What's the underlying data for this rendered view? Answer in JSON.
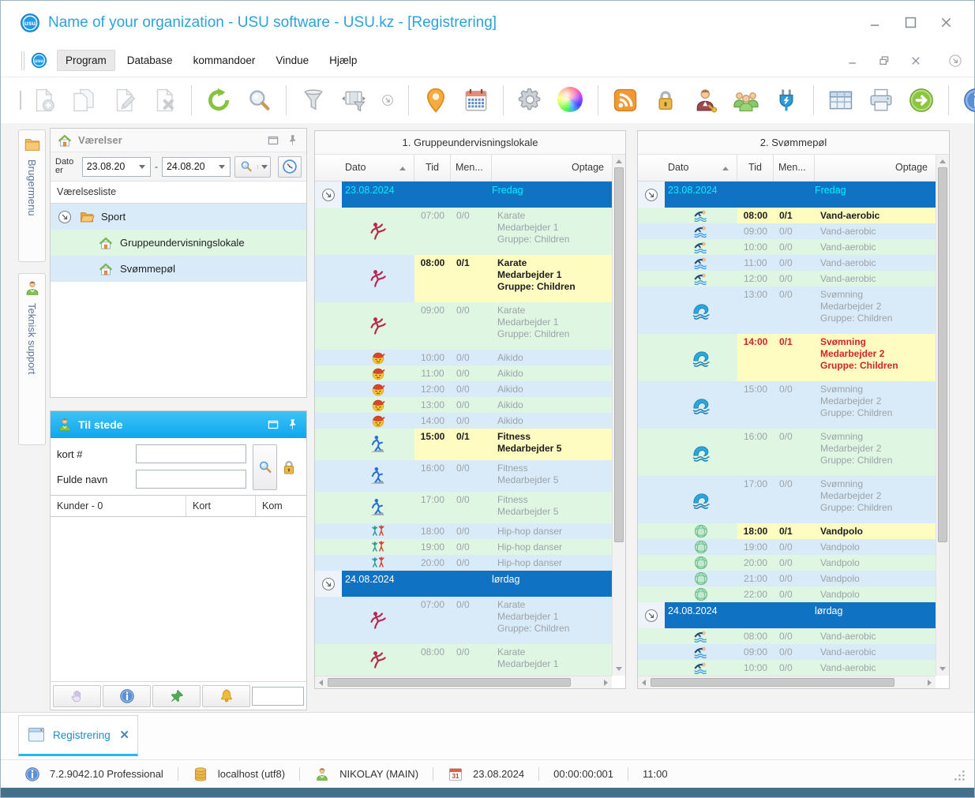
{
  "window": {
    "title": "Name of your organization - USU software - USU.kz - [Registrering]"
  },
  "menu": {
    "items": [
      "Program",
      "Database",
      "kommandoer",
      "Vindue",
      "Hjælp"
    ]
  },
  "toolbar": {
    "buttons": [
      {
        "name": "new-record-button",
        "icon": "new-document-icon",
        "disabled": true
      },
      {
        "name": "copy-record-button",
        "icon": "copy-document-icon",
        "disabled": true
      },
      {
        "name": "edit-record-button",
        "icon": "edit-document-icon",
        "disabled": true
      },
      {
        "name": "delete-record-button",
        "icon": "delete-document-icon",
        "disabled": true
      },
      {
        "sep": true
      },
      {
        "name": "refresh-button",
        "icon": "refresh-icon"
      },
      {
        "name": "search-button",
        "icon": "search-icon"
      },
      {
        "sep": true
      },
      {
        "name": "filter-button",
        "icon": "filter-icon"
      },
      {
        "name": "filter-panel-button",
        "icon": "filter-panel-icon"
      },
      {
        "name": "toolbar-overflow-button",
        "icon": "overflow-arrow-icon",
        "small": true
      },
      {
        "sep": true
      },
      {
        "name": "location-button",
        "icon": "location-pin-icon"
      },
      {
        "name": "calendar-button",
        "icon": "calendar-icon"
      },
      {
        "sep": true
      },
      {
        "name": "settings-button",
        "icon": "settings-gear-icon"
      },
      {
        "name": "appearance-button",
        "icon": "color-palette-icon"
      },
      {
        "sep": true
      },
      {
        "name": "feed-button",
        "icon": "rss-feed-icon"
      },
      {
        "name": "lock-button",
        "icon": "lock-gold-icon"
      },
      {
        "name": "user-access-button",
        "icon": "user-key-icon"
      },
      {
        "name": "user-group-button",
        "icon": "user-group-icon"
      },
      {
        "name": "plugin-button",
        "icon": "plug-icon"
      },
      {
        "sep": true
      },
      {
        "name": "table-view-button",
        "icon": "table-grid-icon"
      },
      {
        "name": "print-button",
        "icon": "printer-icon"
      },
      {
        "name": "go-button",
        "icon": "go-arrow-icon"
      },
      {
        "sep": true
      },
      {
        "name": "info-button",
        "icon": "info-circle-icon"
      },
      {
        "name": "toolbar-overflow-button",
        "icon": "overflow-arrow-icon",
        "small": true
      }
    ]
  },
  "side_tabs": [
    {
      "label": "Brugermenu",
      "icon": "folder-icon"
    },
    {
      "label": "Teknisk support",
      "icon": "person-icon"
    }
  ],
  "rooms_panel": {
    "title": "Værelser",
    "date_label": "Dato er",
    "date_from": "23.08.20",
    "date_to": "24.08.20",
    "list_header": "Værelsesliste",
    "tree": [
      {
        "label": "Sport",
        "icon": "folder-open-icon",
        "expand": true,
        "tint": "blue",
        "indent": 0
      },
      {
        "label": "Gruppeundervisningslokale",
        "icon": "house-icon",
        "tint": "green",
        "indent": 1
      },
      {
        "label": "Svømmepøl",
        "icon": "house-icon",
        "tint": "blue",
        "indent": 1
      }
    ]
  },
  "presence_panel": {
    "title": "Til stede",
    "field1_label": "kort #",
    "field2_label": "Fulde navn",
    "columns": [
      "Kunder - 0",
      "Kort",
      "Kom"
    ]
  },
  "schedules": [
    {
      "title": "1. Gruppeundervisningslokale",
      "columns": {
        "dato": "Dato",
        "tid": "Tid",
        "men": "Men...",
        "optage": "Optage"
      },
      "rows": [
        {
          "type": "date",
          "date": "23.08.2024",
          "day": "Fredag",
          "today": true
        },
        {
          "type": "slot",
          "icon": "karate-icon",
          "time": "07:00",
          "men": "0/0",
          "lines": [
            "Karate",
            "Medarbejder 1",
            "Gruppe: Children"
          ],
          "tint": "green",
          "style": "dim"
        },
        {
          "type": "slot",
          "icon": "karate-icon",
          "time": "08:00",
          "men": "0/1",
          "lines": [
            "Karate",
            "Medarbejder 1",
            "Gruppe: Children"
          ],
          "tint": "blue",
          "highlight": true,
          "style": "bold"
        },
        {
          "type": "slot",
          "icon": "karate-icon",
          "time": "09:00",
          "men": "0/0",
          "lines": [
            "Karate",
            "Medarbejder 1",
            "Gruppe: Children"
          ],
          "tint": "green",
          "style": "dim"
        },
        {
          "type": "slot",
          "icon": "aikido-icon",
          "time": "10:00",
          "men": "0/0",
          "lines": [
            "Aikido"
          ],
          "tint": "blue",
          "style": "dim"
        },
        {
          "type": "slot",
          "icon": "aikido-icon",
          "time": "11:00",
          "men": "0/0",
          "lines": [
            "Aikido"
          ],
          "tint": "green",
          "style": "dim"
        },
        {
          "type": "slot",
          "icon": "aikido-icon",
          "time": "12:00",
          "men": "0/0",
          "lines": [
            "Aikido"
          ],
          "tint": "blue",
          "style": "dim"
        },
        {
          "type": "slot",
          "icon": "aikido-icon",
          "time": "13:00",
          "men": "0/0",
          "lines": [
            "Aikido"
          ],
          "tint": "green",
          "style": "dim"
        },
        {
          "type": "slot",
          "icon": "aikido-icon",
          "time": "14:00",
          "men": "0/0",
          "lines": [
            "Aikido"
          ],
          "tint": "blue",
          "style": "dim"
        },
        {
          "type": "slot",
          "icon": "fitness-icon",
          "time": "15:00",
          "men": "0/1",
          "lines": [
            "Fitness",
            "Medarbejder 5"
          ],
          "tint": "green",
          "highlight": true,
          "style": "bold"
        },
        {
          "type": "slot",
          "icon": "fitness-icon",
          "time": "16:00",
          "men": "0/0",
          "lines": [
            "Fitness",
            "Medarbejder 5"
          ],
          "tint": "blue",
          "style": "dim"
        },
        {
          "type": "slot",
          "icon": "fitness-icon",
          "time": "17:00",
          "men": "0/0",
          "lines": [
            "Fitness",
            "Medarbejder 5"
          ],
          "tint": "green",
          "style": "dim"
        },
        {
          "type": "slot",
          "icon": "hiphop-icon",
          "time": "18:00",
          "men": "0/0",
          "lines": [
            "Hip-hop danser"
          ],
          "tint": "blue",
          "style": "dim"
        },
        {
          "type": "slot",
          "icon": "hiphop-icon",
          "time": "19:00",
          "men": "0/0",
          "lines": [
            "Hip-hop danser"
          ],
          "tint": "green",
          "style": "dim"
        },
        {
          "type": "slot",
          "icon": "hiphop-icon",
          "time": "20:00",
          "men": "0/0",
          "lines": [
            "Hip-hop danser"
          ],
          "tint": "blue",
          "style": "dim"
        },
        {
          "type": "date",
          "date": "24.08.2024",
          "day": "lørdag"
        },
        {
          "type": "slot",
          "icon": "karate-icon",
          "time": "07:00",
          "men": "0/0",
          "lines": [
            "Karate",
            "Medarbejder 1",
            "Gruppe: Children"
          ],
          "tint": "blue",
          "style": "dim"
        },
        {
          "type": "slot",
          "icon": "karate-icon",
          "time": "08:00",
          "men": "0/0",
          "lines": [
            "Karate",
            "Medarbejder 1"
          ],
          "tint": "green",
          "style": "dim"
        }
      ]
    },
    {
      "title": "2. Svømmepøl",
      "columns": {
        "dato": "Dato",
        "tid": "Tid",
        "men": "Men...",
        "optage": "Optage"
      },
      "rows": [
        {
          "type": "date",
          "date": "23.08.2024",
          "day": "Fredag",
          "today": true
        },
        {
          "type": "slot",
          "icon": "aqua-swimmer-icon",
          "time": "08:00",
          "men": "0/1",
          "lines": [
            "Vand-aerobic"
          ],
          "tint": "green",
          "highlight": true,
          "style": "bold"
        },
        {
          "type": "slot",
          "icon": "aqua-swimmer-icon",
          "time": "09:00",
          "men": "0/0",
          "lines": [
            "Vand-aerobic"
          ],
          "tint": "blue",
          "style": "dim"
        },
        {
          "type": "slot",
          "icon": "aqua-swimmer-icon",
          "time": "10:00",
          "men": "0/0",
          "lines": [
            "Vand-aerobic"
          ],
          "tint": "green",
          "style": "dim"
        },
        {
          "type": "slot",
          "icon": "aqua-swimmer-icon",
          "time": "11:00",
          "men": "0/0",
          "lines": [
            "Vand-aerobic"
          ],
          "tint": "blue",
          "style": "dim"
        },
        {
          "type": "slot",
          "icon": "aqua-swimmer-icon",
          "time": "12:00",
          "men": "0/0",
          "lines": [
            "Vand-aerobic"
          ],
          "tint": "green",
          "style": "dim"
        },
        {
          "type": "slot",
          "icon": "swim-wave-icon",
          "time": "13:00",
          "men": "0/0",
          "lines": [
            "Svømning",
            "Medarbejder 2",
            "Gruppe: Children"
          ],
          "tint": "blue",
          "style": "dim"
        },
        {
          "type": "slot",
          "icon": "swim-wave-icon",
          "time": "14:00",
          "men": "0/1",
          "lines": [
            "Svømning",
            "Medarbejder 2",
            "Gruppe: Children"
          ],
          "tint": "green",
          "highlight": true,
          "style": "red"
        },
        {
          "type": "slot",
          "icon": "swim-wave-icon",
          "time": "15:00",
          "men": "0/0",
          "lines": [
            "Svømning",
            "Medarbejder 2",
            "Gruppe: Children"
          ],
          "tint": "blue",
          "style": "dim"
        },
        {
          "type": "slot",
          "icon": "swim-wave-icon",
          "time": "16:00",
          "men": "0/0",
          "lines": [
            "Svømning",
            "Medarbejder 2",
            "Gruppe: Children"
          ],
          "tint": "green",
          "style": "dim"
        },
        {
          "type": "slot",
          "icon": "swim-wave-icon",
          "time": "17:00",
          "men": "0/0",
          "lines": [
            "Svømning",
            "Medarbejder 2",
            "Gruppe: Children"
          ],
          "tint": "blue",
          "style": "dim"
        },
        {
          "type": "slot",
          "icon": "waterpolo-icon",
          "time": "18:00",
          "men": "0/1",
          "lines": [
            "Vandpolo"
          ],
          "tint": "green",
          "highlight": true,
          "style": "bold"
        },
        {
          "type": "slot",
          "icon": "waterpolo-icon",
          "time": "19:00",
          "men": "0/0",
          "lines": [
            "Vandpolo"
          ],
          "tint": "blue",
          "style": "dim"
        },
        {
          "type": "slot",
          "icon": "waterpolo-icon",
          "time": "20:00",
          "men": "0/0",
          "lines": [
            "Vandpolo"
          ],
          "tint": "green",
          "style": "dim"
        },
        {
          "type": "slot",
          "icon": "waterpolo-icon",
          "time": "21:00",
          "men": "0/0",
          "lines": [
            "Vandpolo"
          ],
          "tint": "blue",
          "style": "dim"
        },
        {
          "type": "slot",
          "icon": "waterpolo-icon",
          "time": "22:00",
          "men": "0/0",
          "lines": [
            "Vandpolo"
          ],
          "tint": "green",
          "style": "dim"
        },
        {
          "type": "date",
          "date": "24.08.2024",
          "day": "lørdag"
        },
        {
          "type": "slot",
          "icon": "aqua-swimmer-icon",
          "time": "08:00",
          "men": "0/0",
          "lines": [
            "Vand-aerobic"
          ],
          "tint": "green",
          "style": "dim"
        },
        {
          "type": "slot",
          "icon": "aqua-swimmer-icon",
          "time": "09:00",
          "men": "0/0",
          "lines": [
            "Vand-aerobic"
          ],
          "tint": "blue",
          "style": "dim"
        },
        {
          "type": "slot",
          "icon": "aqua-swimmer-icon",
          "time": "10:00",
          "men": "0/0",
          "lines": [
            "Vand-aerobic"
          ],
          "tint": "green",
          "style": "dim"
        }
      ]
    }
  ],
  "doc_tabs": [
    {
      "label": "Registrering"
    }
  ],
  "status_bar": {
    "version": "7.2.9042.10 Professional",
    "host": "localhost (utf8)",
    "user": "NIKOLAY (MAIN)",
    "date": "23.08.2024",
    "timer": "00:00:00:001",
    "time": "11:00"
  },
  "colors": {
    "accent_blue": "#0f72c2",
    "highlight_yellow": "#fffcc2",
    "row_green": "#dff6e3",
    "row_blue": "#d9eaf9",
    "today_cyan": "#00f0ff",
    "panel_header_blue": "#1fb2f2",
    "title_blue": "#2aa3df",
    "alert_red": "#d2232a"
  }
}
